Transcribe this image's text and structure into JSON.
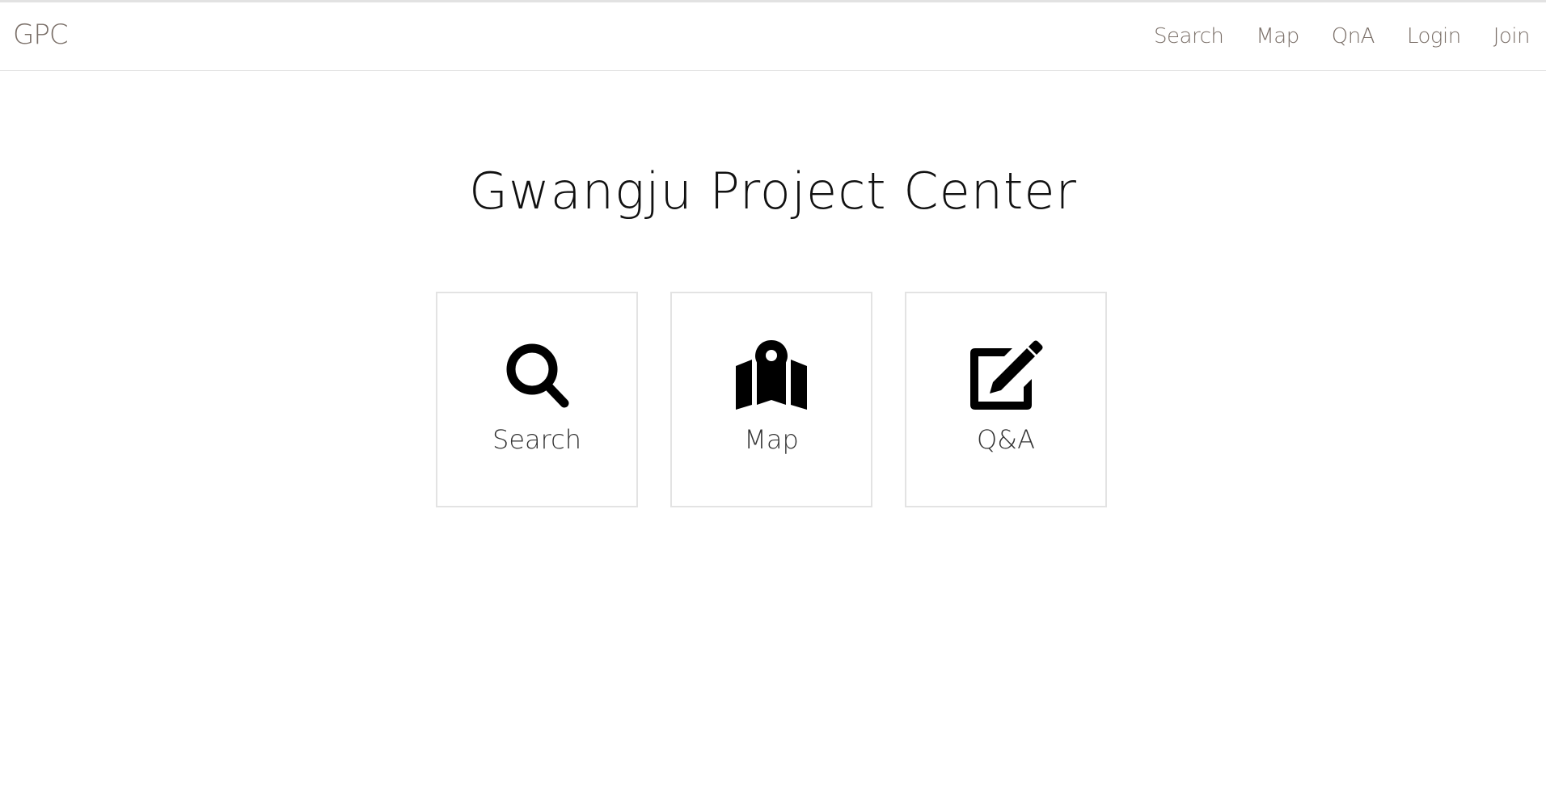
{
  "header": {
    "brand": "GPC",
    "nav": [
      {
        "label": "Search",
        "icon": "search-nav"
      },
      {
        "label": "Map"
      },
      {
        "label": "QnA"
      },
      {
        "label": "Login"
      },
      {
        "label": "Join"
      }
    ]
  },
  "main": {
    "title": "Gwangju Project Center",
    "cards": [
      {
        "label": "Search",
        "icon": "search-icon"
      },
      {
        "label": "Map",
        "icon": "map-marker-icon"
      },
      {
        "label": "Q&A",
        "icon": "edit-icon"
      }
    ]
  },
  "colors": {
    "nav_text": "#7a6f68",
    "icon": "#000000",
    "card_border": "#e3e3e3"
  }
}
